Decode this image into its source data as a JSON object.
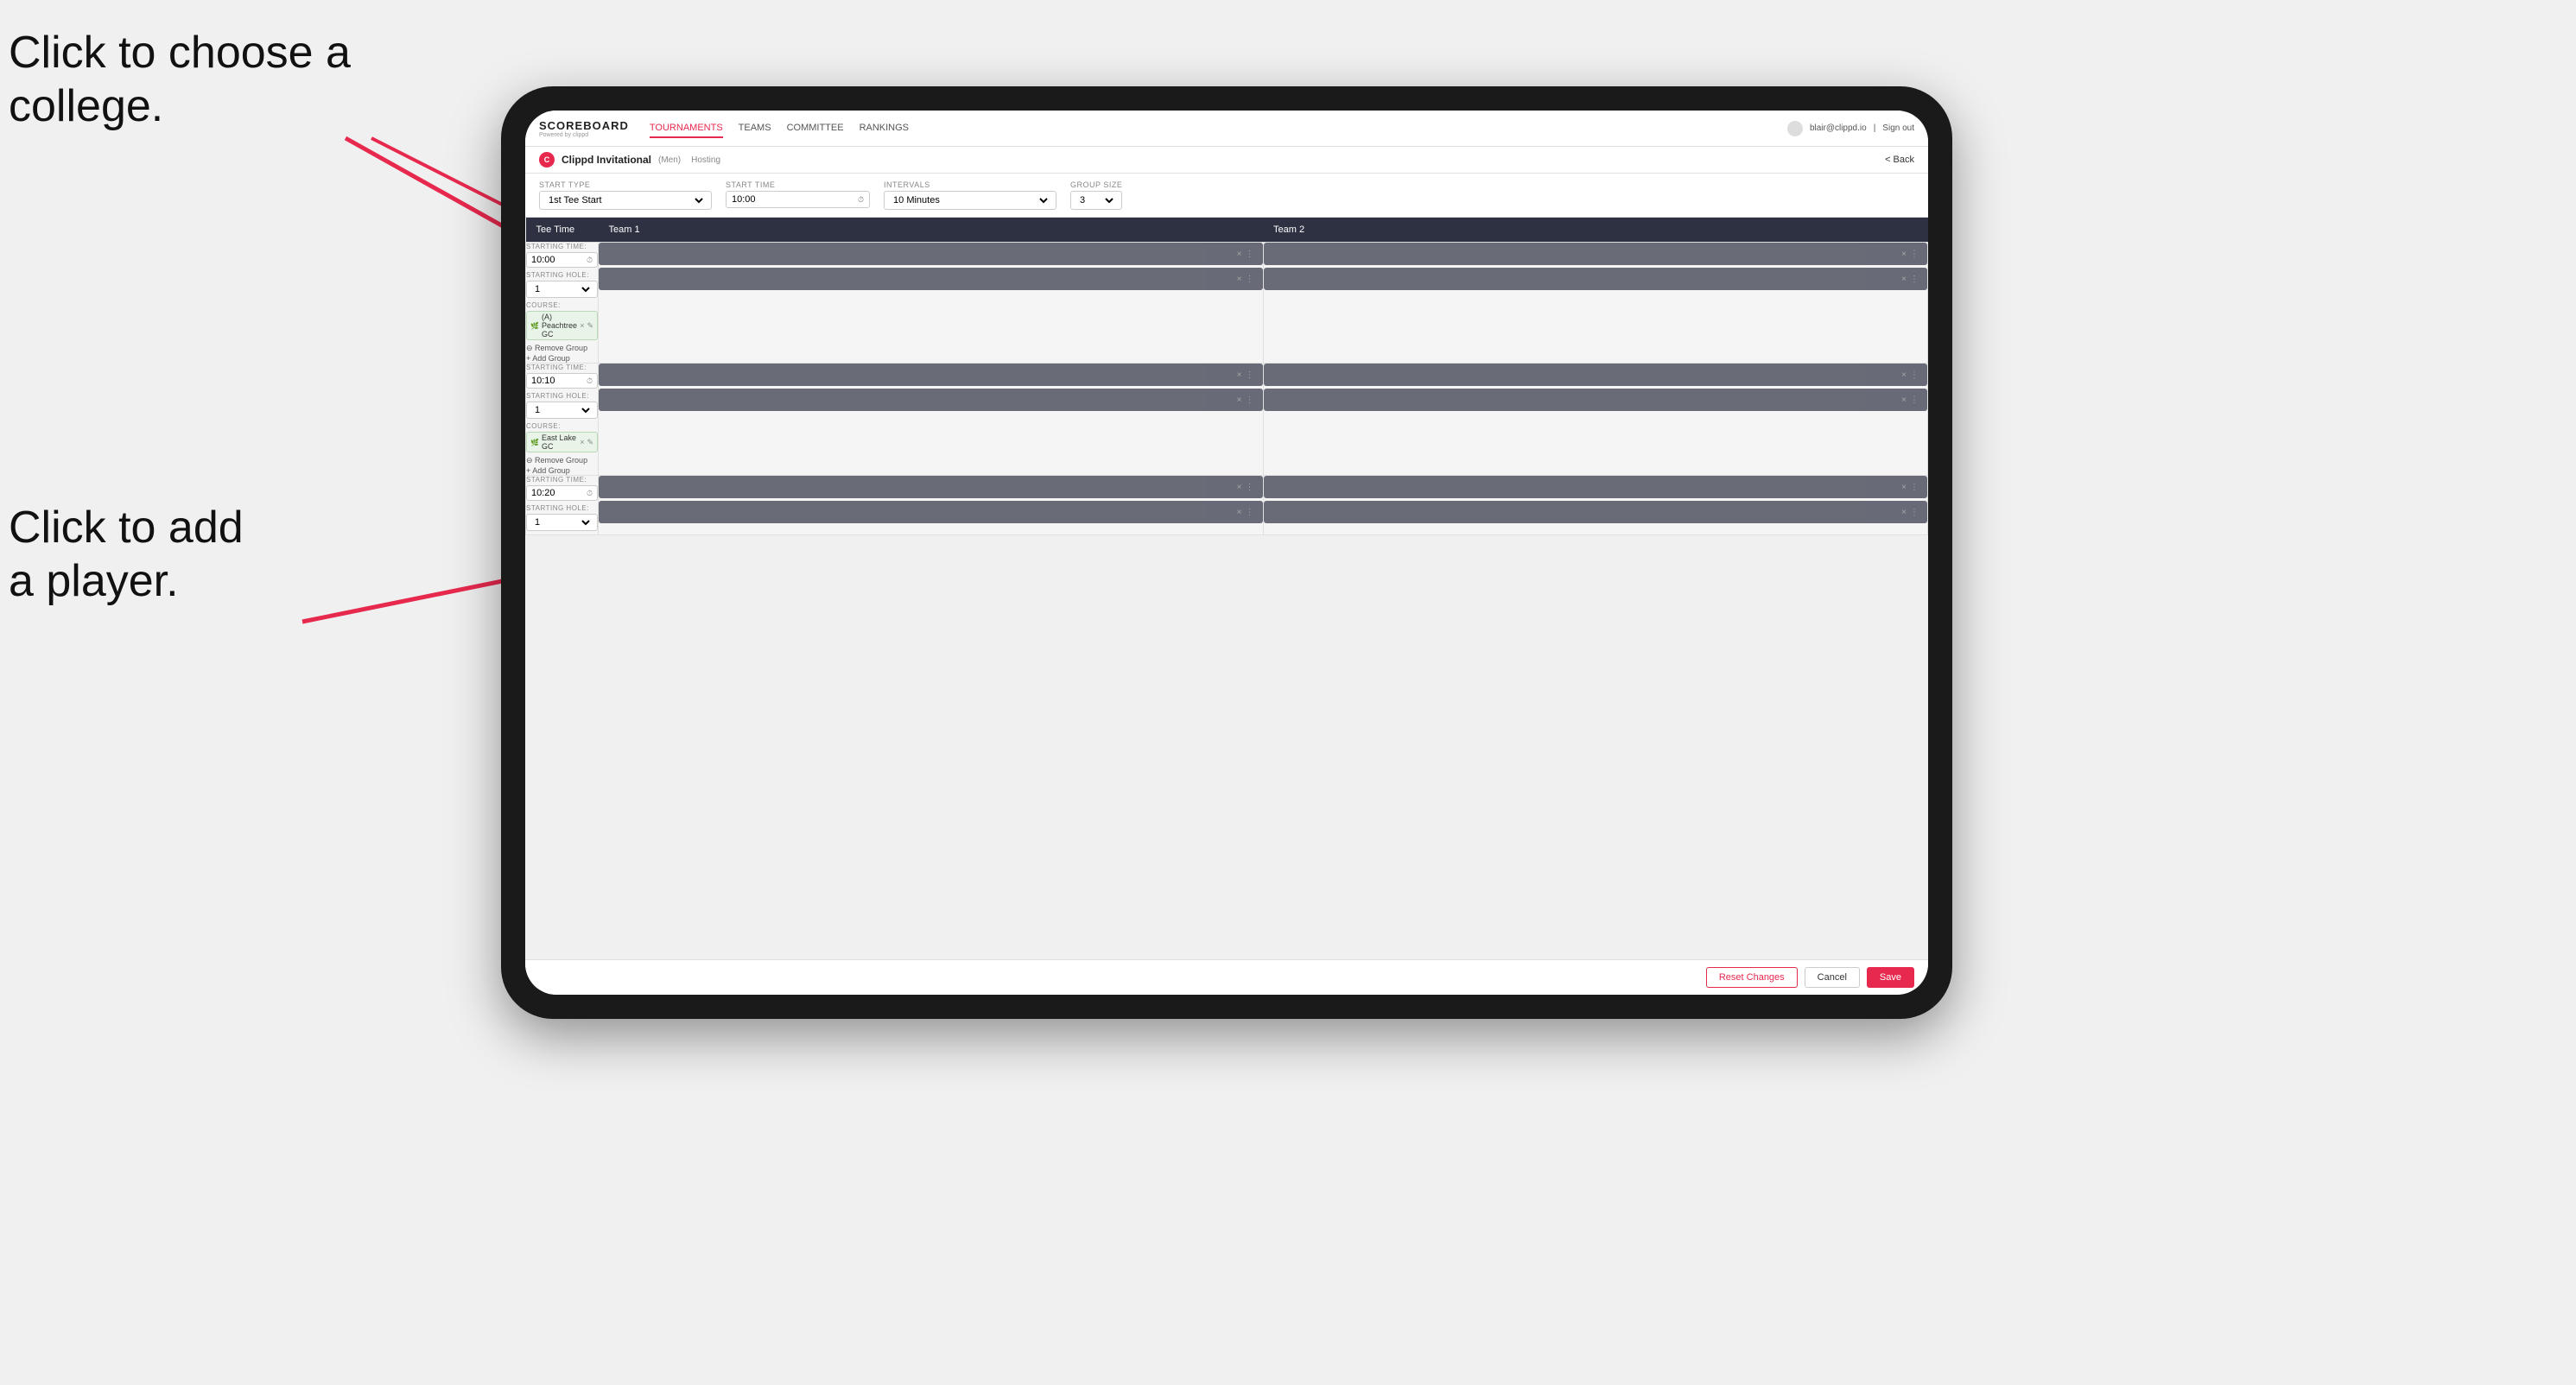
{
  "annotations": {
    "ann1": "Click to choose a\ncollege.",
    "ann2": "Click to add\na player."
  },
  "header": {
    "logo": "SCOREBOARD",
    "powered_by": "Powered by clippd",
    "nav": [
      "TOURNAMENTS",
      "TEAMS",
      "COMMITTEE",
      "RANKINGS"
    ],
    "user_email": "blair@clippd.io",
    "sign_out": "Sign out"
  },
  "breadcrumb": {
    "tournament": "Clippd Invitational",
    "gender": "(Men)",
    "status": "Hosting",
    "back": "< Back"
  },
  "form": {
    "start_type_label": "Start Type",
    "start_type_value": "1st Tee Start",
    "start_time_label": "Start Time",
    "start_time_value": "10:00",
    "intervals_label": "Intervals",
    "intervals_value": "10 Minutes",
    "group_size_label": "Group Size",
    "group_size_value": "3"
  },
  "table": {
    "col_tee_time": "Tee Time",
    "col_team1": "Team 1",
    "col_team2": "Team 2"
  },
  "groups": [
    {
      "starting_time": "10:00",
      "starting_hole": "1",
      "course": "(A) Peachtree GC",
      "course_icon": "🌿",
      "team1_players": [
        {
          "empty": true
        },
        {
          "empty": true
        }
      ],
      "team2_players": [
        {
          "empty": true
        },
        {
          "empty": true
        }
      ]
    },
    {
      "starting_time": "10:10",
      "starting_hole": "1",
      "course": "East Lake GC",
      "course_icon": "🌿",
      "team1_players": [
        {
          "empty": true
        },
        {
          "empty": true
        }
      ],
      "team2_players": [
        {
          "empty": true
        },
        {
          "empty": true
        }
      ]
    },
    {
      "starting_time": "10:20",
      "starting_hole": "1",
      "course": "",
      "course_icon": "",
      "team1_players": [
        {
          "empty": true
        },
        {
          "empty": true
        }
      ],
      "team2_players": [
        {
          "empty": true
        },
        {
          "empty": true
        }
      ]
    }
  ],
  "footer": {
    "reset_label": "Reset Changes",
    "cancel_label": "Cancel",
    "save_label": "Save"
  }
}
